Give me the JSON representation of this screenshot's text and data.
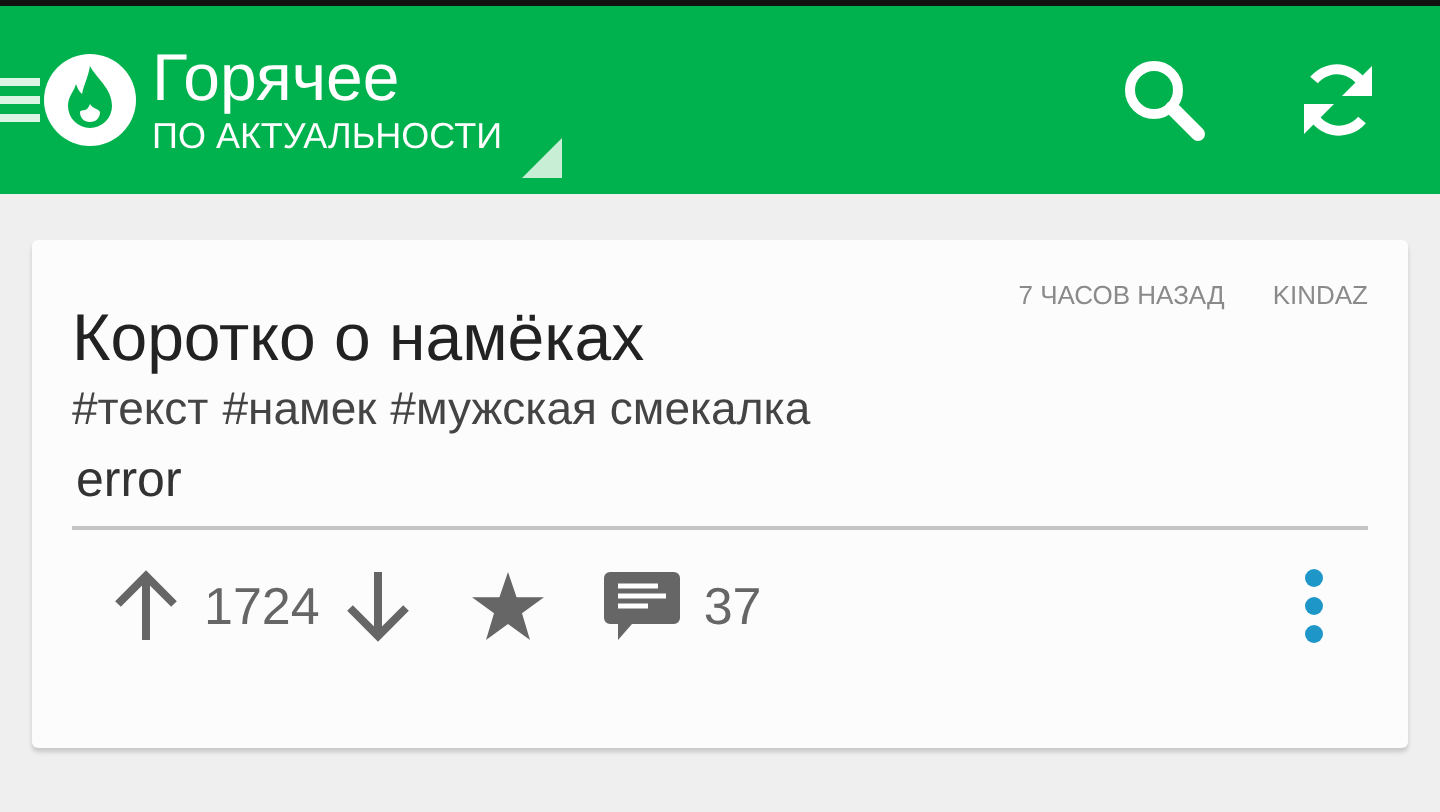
{
  "app_bar": {
    "title": "Горячее",
    "subtitle": "ПО АКТУАЛЬНОСТИ"
  },
  "post": {
    "time": "7 ЧАСОВ НАЗАД",
    "author": "KINDAZ",
    "title": "Коротко о намёках",
    "tags": [
      "#текст",
      "#намек",
      "#мужская смекалка"
    ],
    "body": "error",
    "rating": "1724",
    "comments": "37"
  }
}
